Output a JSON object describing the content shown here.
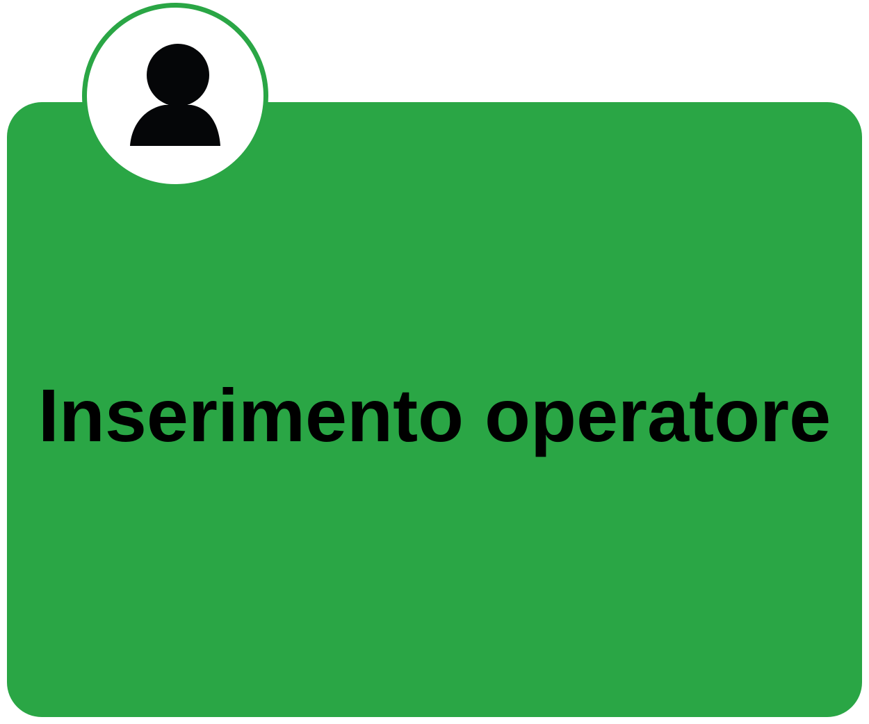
{
  "card": {
    "title": "Inserimento operatore",
    "accent_color": "#2aa645",
    "icon": "user-icon"
  }
}
